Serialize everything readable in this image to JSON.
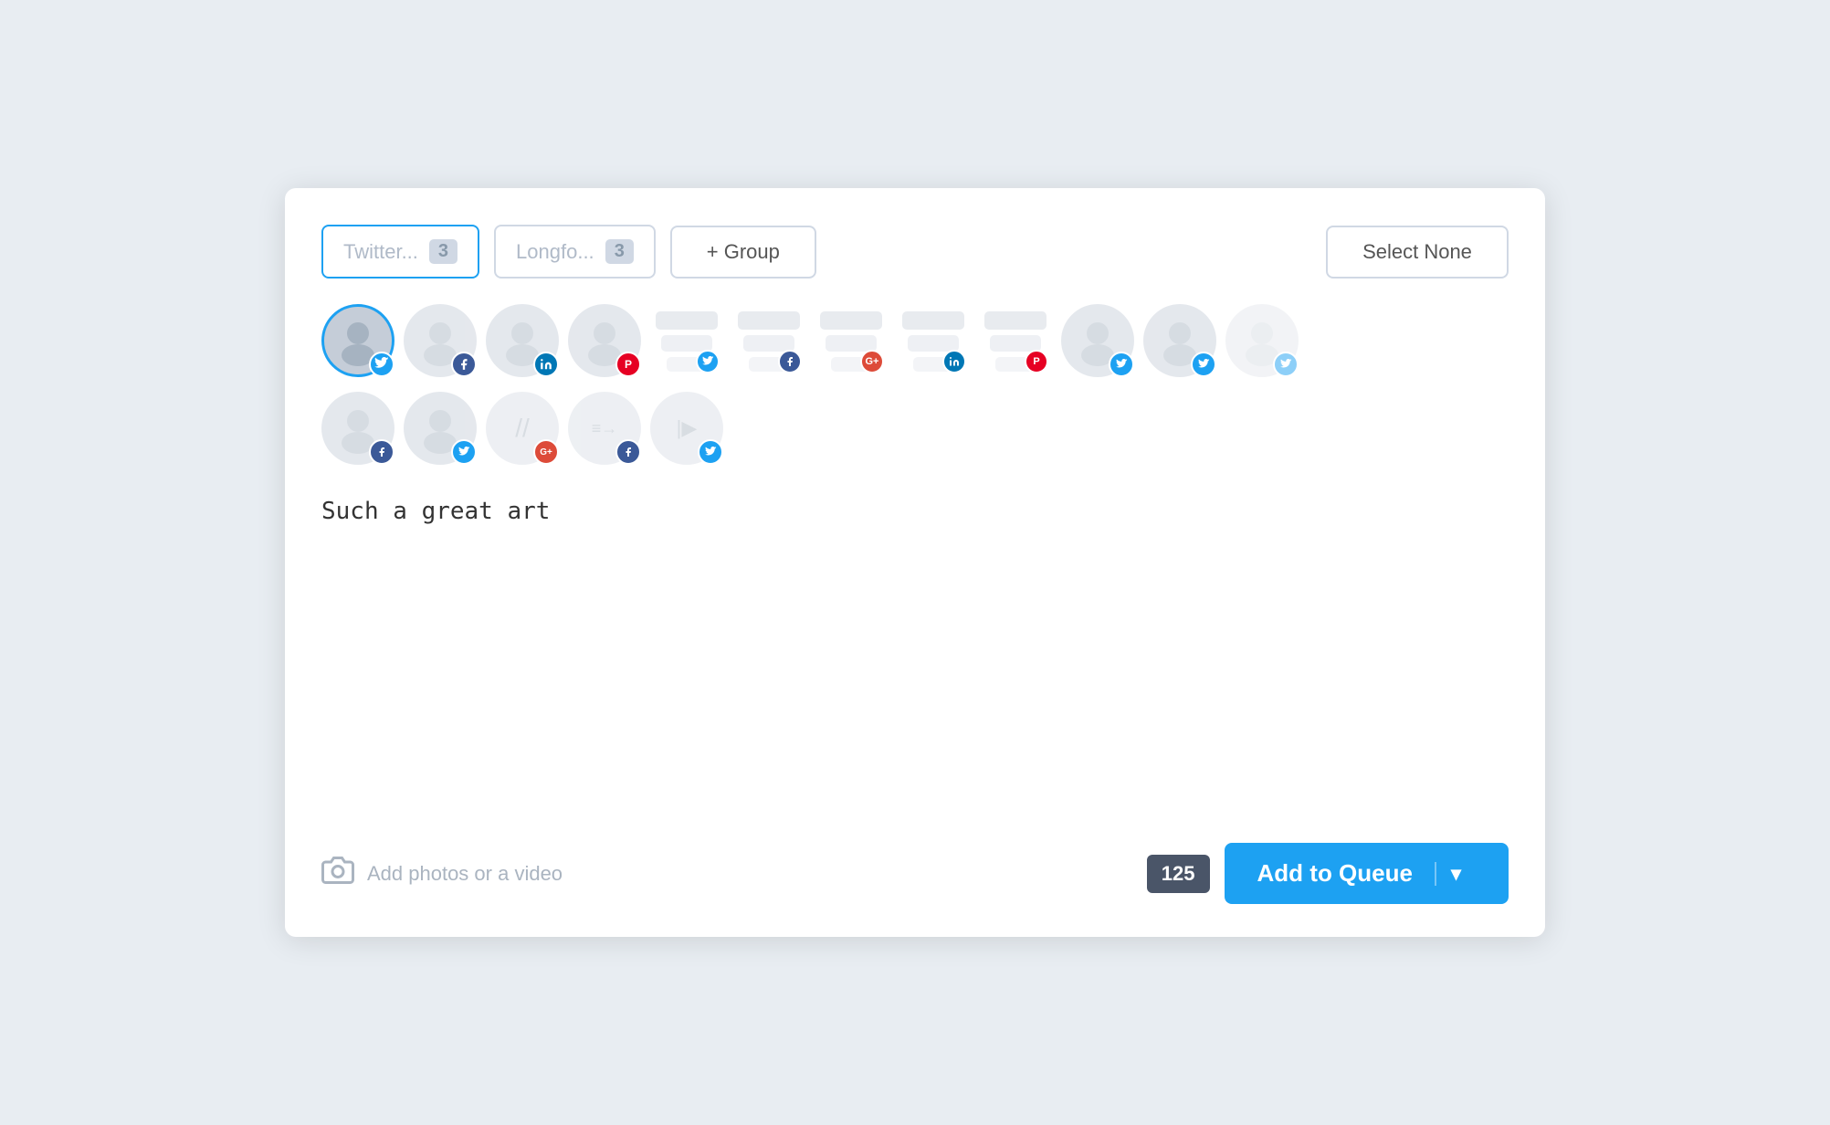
{
  "toolbar": {
    "twitter_label": "Twitter...",
    "twitter_count": "3",
    "longform_label": "Longfo...",
    "longform_count": "3",
    "group_label": "+ Group",
    "select_none_label": "Select None"
  },
  "compose": {
    "text": "Such a great art",
    "char_count": "125",
    "photo_label": "Add photos or a video"
  },
  "bottom": {
    "add_queue_label": "Add to Queue",
    "add_queue_arrow": "▾"
  },
  "accounts_row1": [
    {
      "type": "person",
      "social": "twitter",
      "selected": true
    },
    {
      "type": "person",
      "social": "facebook",
      "selected": false
    },
    {
      "type": "person",
      "social": "linkedin",
      "selected": false
    },
    {
      "type": "person",
      "social": "pinterest",
      "selected": false
    },
    {
      "type": "stack",
      "social": "twitter",
      "selected": false
    },
    {
      "type": "stack",
      "social": "facebook",
      "selected": false
    },
    {
      "type": "stack",
      "social": "googleplus",
      "selected": false
    },
    {
      "type": "stack",
      "social": "linkedin",
      "selected": false
    },
    {
      "type": "stack",
      "social": "pinterest",
      "selected": false
    },
    {
      "type": "person",
      "social": "twitter",
      "selected": false
    },
    {
      "type": "person",
      "social": "twitter",
      "selected": false
    },
    {
      "type": "person",
      "social": "twitter",
      "selected": false
    }
  ],
  "accounts_row2": [
    {
      "type": "person",
      "social": "facebook",
      "selected": false
    },
    {
      "type": "person",
      "social": "twitter",
      "selected": false
    },
    {
      "type": "slash",
      "social": "googleplus",
      "selected": false
    },
    {
      "type": "slash2",
      "social": "facebook",
      "selected": false
    },
    {
      "type": "bars",
      "social": "twitter",
      "selected": false
    }
  ]
}
